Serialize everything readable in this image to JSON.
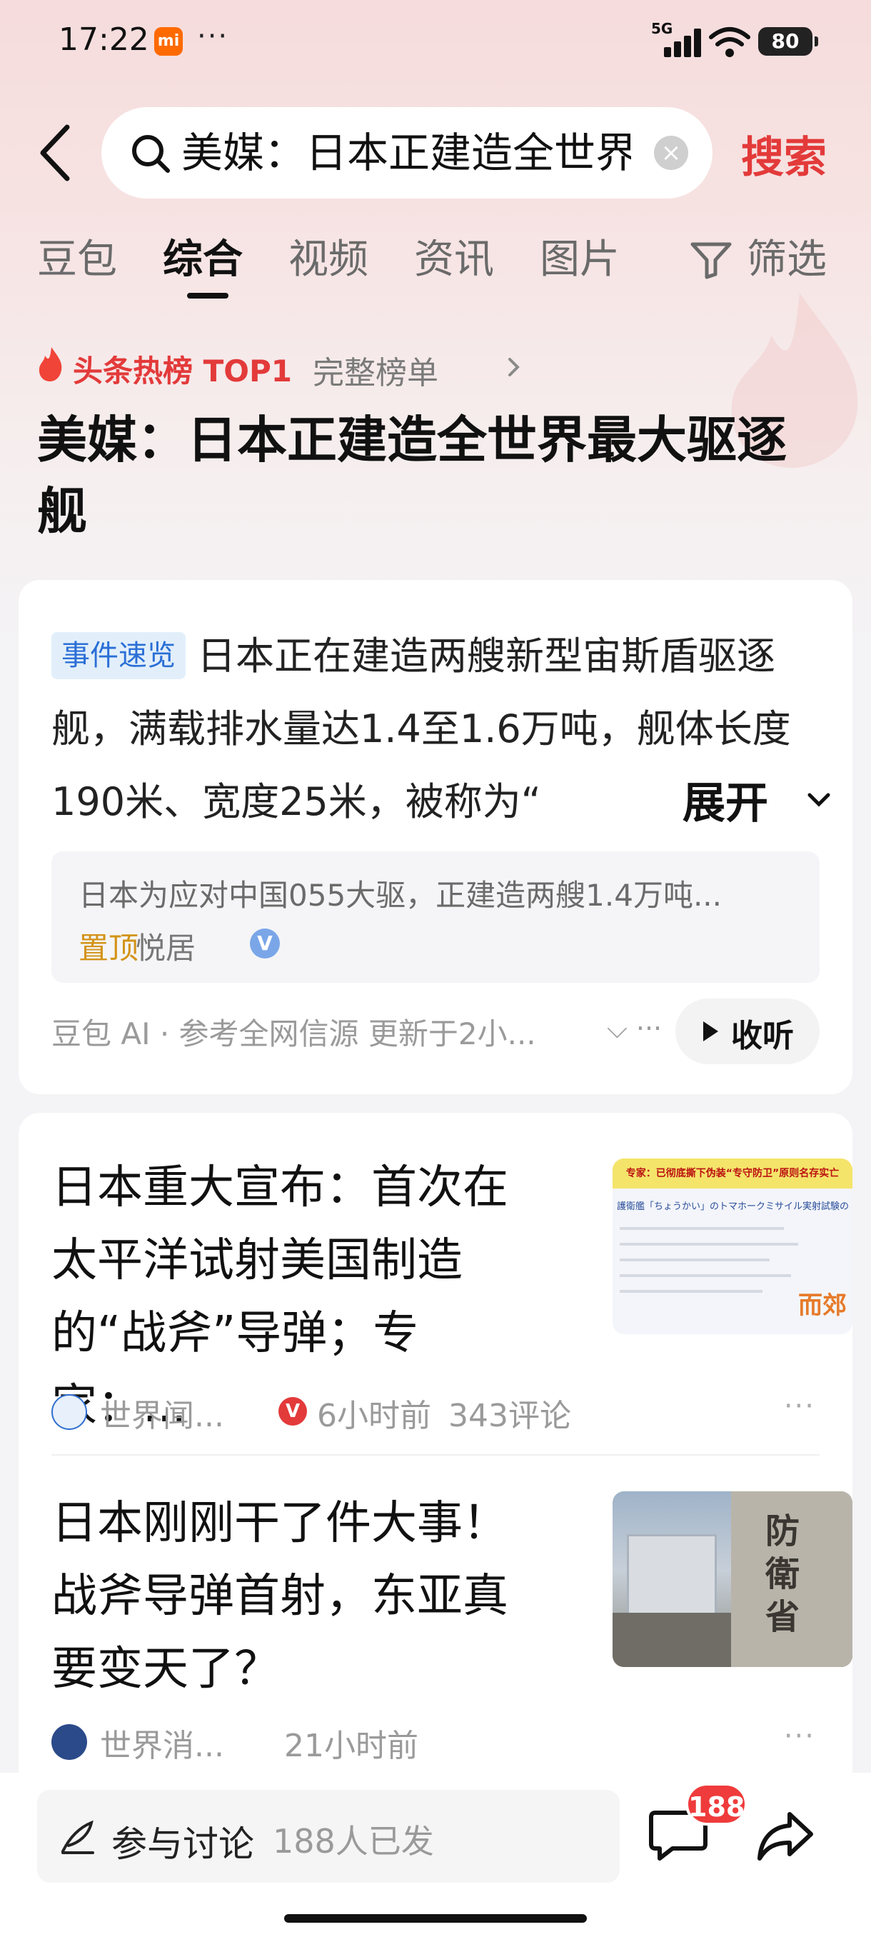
{
  "status_bar": {
    "time": "17:22",
    "mi_badge": "mi",
    "dots": "···",
    "network": "5G",
    "battery": "80"
  },
  "search": {
    "query": "美媒：日本正建造全世界最大驱逐舰",
    "button": "搜索"
  },
  "tabs": [
    {
      "label": "豆包"
    },
    {
      "label": "综合"
    },
    {
      "label": "视频"
    },
    {
      "label": "资讯"
    },
    {
      "label": "图片"
    },
    {
      "label": "筛选"
    }
  ],
  "hot_rank": {
    "label": "头条热榜 TOP1",
    "link": "完整榜单"
  },
  "headline": "美媒：日本正建造全世界最大驱逐舰",
  "summary_card": {
    "badge": "事件速览",
    "text": "日本正在建造两艘新型宙斯盾驱逐舰，满载排水量达1.4至1.6万吨，舰体长度190米、宽度25米，被称为“",
    "expand": "展开",
    "quote": "日本为应对中国055大驱，正建造两艘1.4万吨...",
    "quote_pin": "置顶",
    "quote_author": "悦居",
    "verified": "V",
    "source_line": "豆包 AI · 参考全网信源 更新于2小...",
    "listen": "收听"
  },
  "articles": [
    {
      "title": "日本重大宣布：首次在太平洋试射美国制造的“战斧”导弹；专家：...",
      "source": "世界闻...",
      "verified": "V",
      "time": "6小时前",
      "comments": "343评论",
      "more": "···",
      "thumb_caption": "专家：已彻底撕下伪装“专守防卫”原则名存实亡",
      "thumb_subtitle": "護衛艦「ちょうかい」のトマホークミサイル実射試験の実施について",
      "thumb_logo": "而郊"
    },
    {
      "title": "日本刚刚干了件大事！战斧导弹首射，东亚真要变天了？",
      "source": "世界消...",
      "time": "21小时前",
      "more": "···",
      "thumb_sign": "防衛省"
    }
  ],
  "bottom_bar": {
    "discuss": "参与讨论",
    "discuss_count": "188人已发",
    "comment_badge": "188"
  },
  "colors": {
    "accent_red": "#e33a3a",
    "badge_blue": "#2b6fd6",
    "pin_gold": "#d39318"
  }
}
